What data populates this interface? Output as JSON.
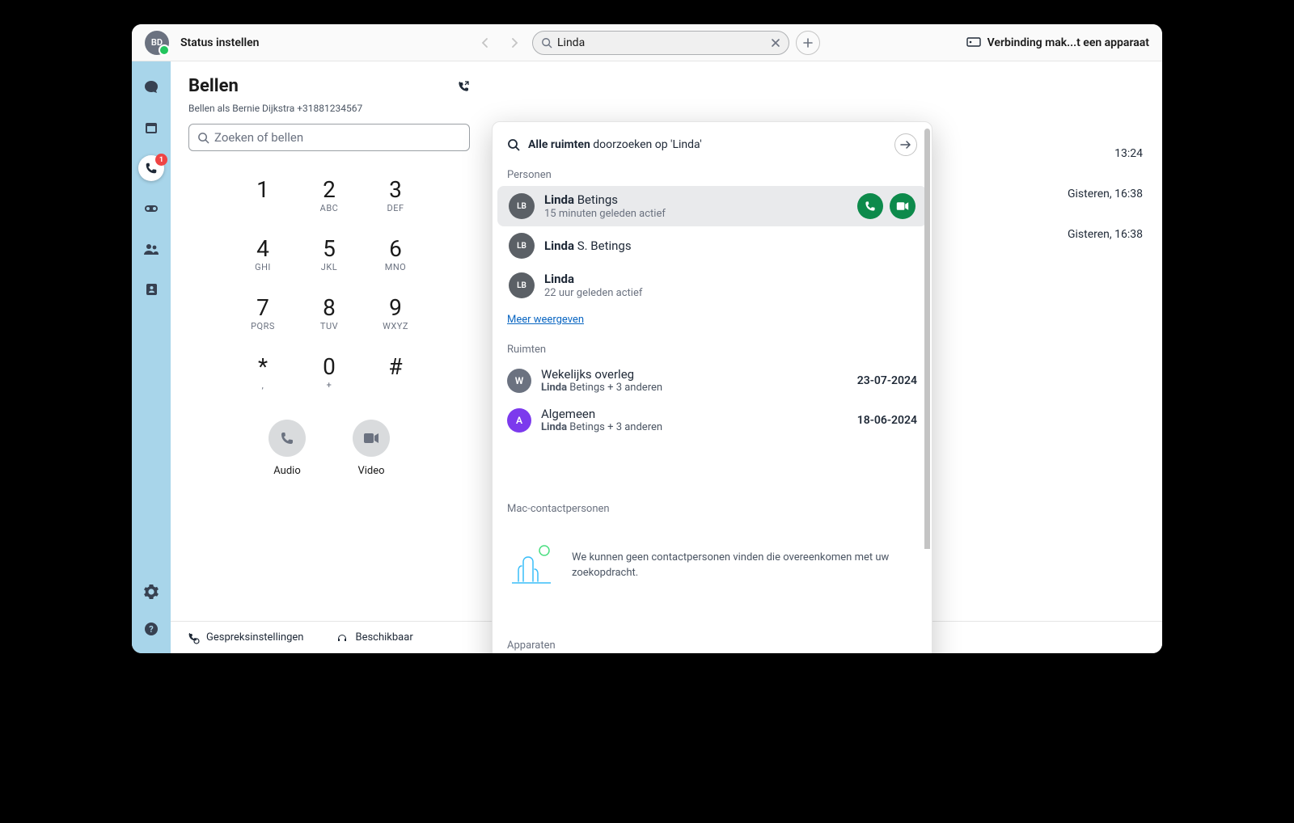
{
  "titlebar": {
    "avatar_initials": "BD",
    "status_text": "Status instellen",
    "search_value": "Linda",
    "connect_device": "Verbinding mak...t een apparaat"
  },
  "sidebar": {
    "phone_badge": "1"
  },
  "call_panel": {
    "title": "Bellen",
    "subtitle": "Bellen als Bernie Dijkstra +31881234567",
    "search_placeholder": "Zoeken of bellen",
    "keys": [
      {
        "num": "1",
        "sub": ""
      },
      {
        "num": "2",
        "sub": "ABC"
      },
      {
        "num": "3",
        "sub": "DEF"
      },
      {
        "num": "4",
        "sub": "GHI"
      },
      {
        "num": "5",
        "sub": "JKL"
      },
      {
        "num": "6",
        "sub": "MNO"
      },
      {
        "num": "7",
        "sub": "PQRS"
      },
      {
        "num": "8",
        "sub": "TUV"
      },
      {
        "num": "9",
        "sub": "WXYZ"
      },
      {
        "num": "*",
        "sub": ","
      },
      {
        "num": "0",
        "sub": "+"
      },
      {
        "num": "#",
        "sub": ""
      }
    ],
    "audio_label": "Audio",
    "video_label": "Video"
  },
  "footer": {
    "settings": "Gespreksinstellingen",
    "availability": "Beschikbaar"
  },
  "right_times": [
    "13:24",
    "Gisteren, 16:38",
    "Gisteren, 16:38"
  ],
  "dropdown": {
    "search_all_prefix": "Alle ruimten",
    "search_all_suffix": " doorzoeken op 'Linda'",
    "label_people": "Personen",
    "people": [
      {
        "initials": "LB",
        "bold": "Linda",
        "rest": " Betings",
        "sub": "15 minuten geleden actief",
        "hover": true
      },
      {
        "initials": "LB",
        "bold": "Linda",
        "rest": " S. Betings",
        "sub": "",
        "hover": false
      },
      {
        "initials": "LB",
        "bold": "Linda",
        "rest": "",
        "sub": "22 uur geleden actief",
        "hover": false
      }
    ],
    "more_label": "Meer weergeven",
    "label_rooms": "Ruimten",
    "rooms": [
      {
        "avatar": "W",
        "color": "#6b7280",
        "title": "Wekelijks overleg",
        "sub_bold": "Linda",
        "sub_rest": " Betings + 3 anderen",
        "date": "23-07-2024"
      },
      {
        "avatar": "A",
        "color": "#7c3aed",
        "title": "Algemeen",
        "sub_bold": "Linda",
        "sub_rest": " Betings + 3 anderen",
        "date": "18-06-2024"
      }
    ],
    "label_mac": "Mac-contactpersonen",
    "empty_text": "We kunnen geen contactpersonen vinden die overeenkomen met uw zoekopdracht.",
    "label_devices": "Apparaten"
  }
}
